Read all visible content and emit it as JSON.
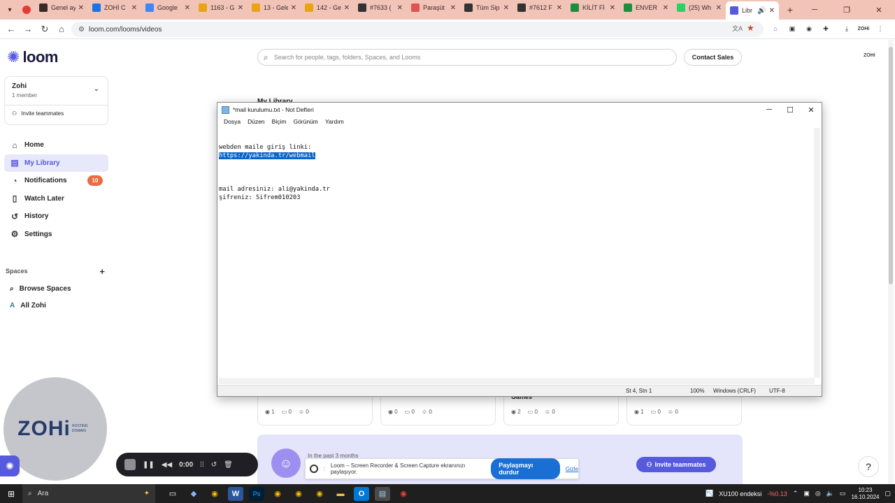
{
  "browser": {
    "tabs": [
      {
        "label": "Genel aу",
        "color": "#3b2a26"
      },
      {
        "label": "ZOHİ C",
        "color": "#1a73e8"
      },
      {
        "label": "Google",
        "color": "#4285f4"
      },
      {
        "label": "1163 - G",
        "color": "#e8a317"
      },
      {
        "label": "13 - Gele",
        "color": "#e8a317"
      },
      {
        "label": "142 - Ge",
        "color": "#e8a317"
      },
      {
        "label": "#7633 (",
        "color": "#333333"
      },
      {
        "label": "Paraşüt",
        "color": "#e05252"
      },
      {
        "label": "Tüm Sip",
        "color": "#333333"
      },
      {
        "label": "#7612 F",
        "color": "#333333"
      },
      {
        "label": "KİLİT Fİ",
        "color": "#1e8e3e"
      },
      {
        "label": "ENVER",
        "color": "#1e8e3e"
      },
      {
        "label": "(25) Wh",
        "color": "#25d366"
      },
      {
        "label": "Libr",
        "color": "#565add"
      }
    ],
    "url": "loom.com/looms/videos"
  },
  "sidebar": {
    "brand": "loom",
    "workspace": {
      "name": "Zohi",
      "members": "1 member",
      "invite": "Invite teammates"
    },
    "nav": [
      {
        "label": "Home",
        "icon": "home-icon"
      },
      {
        "label": "My Library",
        "icon": "library-icon"
      },
      {
        "label": "Notifications",
        "icon": "bell-icon",
        "badge": "10"
      },
      {
        "label": "Watch Later",
        "icon": "bookmark-icon"
      },
      {
        "label": "History",
        "icon": "history-icon"
      },
      {
        "label": "Settings",
        "icon": "gear-icon"
      }
    ],
    "spaces_heading": "Spaces",
    "spaces": [
      {
        "label": "Browse Spaces",
        "icon": "search-icon"
      },
      {
        "label": "All Zohi",
        "icon": "A"
      }
    ]
  },
  "header": {
    "search_placeholder": "Search for people, tags, folders, Spaces, and Looms",
    "contact_sales": "Contact Sales",
    "account": "ZOHi"
  },
  "main": {
    "section_title": "My Library",
    "cards": [
      {
        "title": "",
        "views": "1",
        "comments": "0",
        "reactions": "0"
      },
      {
        "title": "",
        "views": "0",
        "comments": "0",
        "reactions": "0"
      },
      {
        "title": "Games",
        "views": "2",
        "comments": "0",
        "reactions": "0"
      },
      {
        "title": "",
        "views": "1",
        "comments": "0",
        "reactions": "0"
      }
    ],
    "promo_text": "In the past 3 months",
    "invite_button": "Invite teammates",
    "help": "?"
  },
  "recorder": {
    "time": "0:00",
    "cam_logo": "ZOHi",
    "cam_sub": "HOSTING DOMAIN",
    "share_text": "Loom – Screen Recorder & Screen Capture ekranınızı paylaşıyor.",
    "stop_share": "Paylaşmayı durdur",
    "hide": "Gizle"
  },
  "notepad": {
    "title": "*mail kurulumu.txt - Not Defteri",
    "menu": [
      "Dosya",
      "Düzen",
      "Biçim",
      "Görünüm",
      "Yardım"
    ],
    "lines": {
      "l1": "webden maile giriş linki:",
      "l2": "https://yakinda.tr/webmail",
      "l3": "mail adresiniz: ali@yakinda.tr",
      "l4": "şifreniz: Sifrem010203"
    },
    "status": {
      "position": "St 4, Stn 1",
      "zoom": "100%",
      "eol": "Windows (CRLF)",
      "encoding": "UTF-8"
    }
  },
  "taskbar": {
    "search": "Ara",
    "ticker_name": "XU100 endeksi",
    "ticker_change": "-%0.13",
    "time": "10:23",
    "date": "16.10.2024"
  }
}
